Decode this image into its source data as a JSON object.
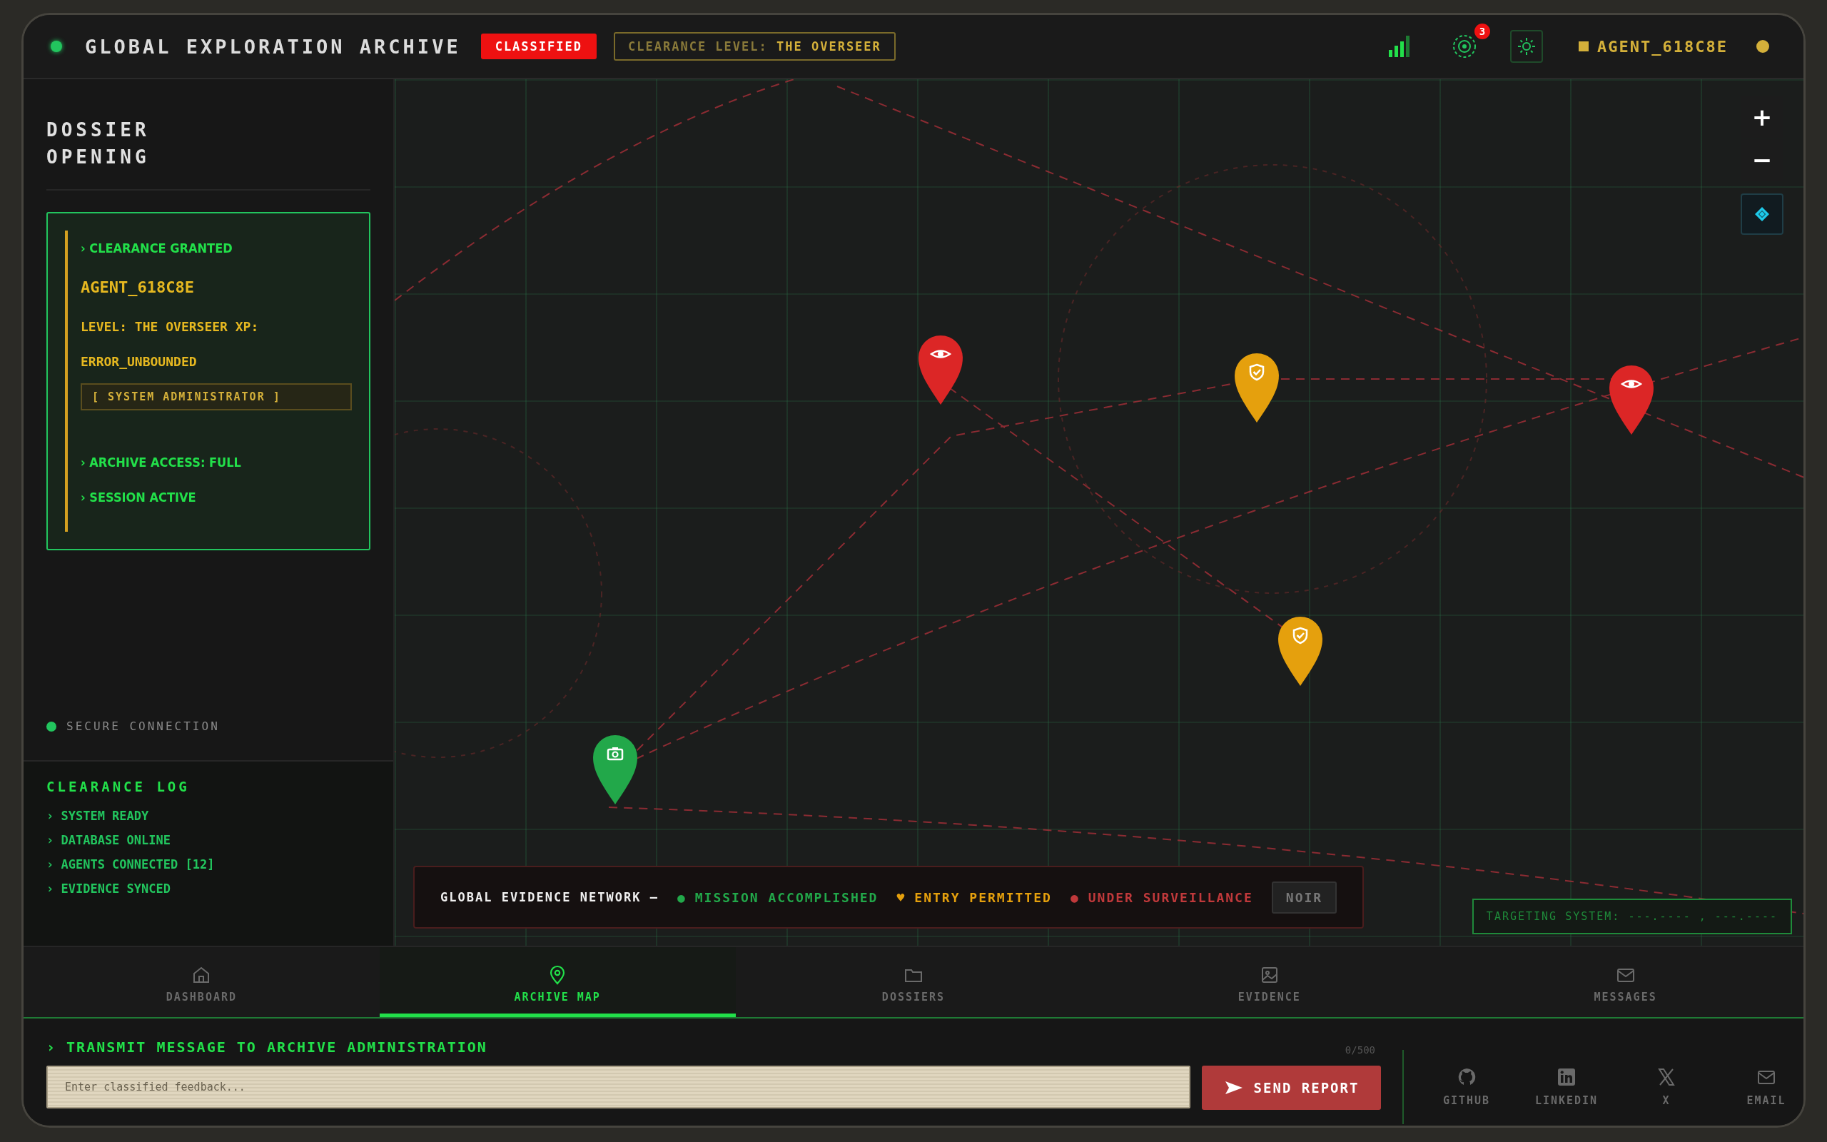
{
  "header": {
    "title": "GLOBAL EXPLORATION ARCHIVE",
    "badge": "CLASSIFIED",
    "clearance_label": "CLEARANCE LEVEL:",
    "clearance_value": "THE OVERSEER",
    "notification_count": "3",
    "agent": "AGENT_618C8E",
    "online": true
  },
  "sidebar": {
    "title": "DOSSIER OPENING",
    "card": {
      "granted": "› CLEARANCE GRANTED",
      "agent": "AGENT_618C8E",
      "level": "LEVEL: THE OVERSEER XP:",
      "xp": "ERROR_UNBOUNDED",
      "role": "[ SYSTEM ADMINISTRATOR ]",
      "access": "› ARCHIVE ACCESS: FULL",
      "session": "› SESSION ACTIVE"
    },
    "connection": {
      "label": "SECURE CONNECTION",
      "secure": true
    },
    "log": {
      "title": "CLEARANCE LOG",
      "entries": [
        "› SYSTEM READY",
        "› DATABASE ONLINE",
        "› AGENTS CONNECTED [12]",
        "› EVIDENCE SYNCED"
      ]
    }
  },
  "map": {
    "zoom_in": "+",
    "zoom_out": "−",
    "pins": [
      {
        "color": "#dc2626"
      },
      {
        "color": "#e5a00d"
      },
      {
        "color": "#dc2626"
      },
      {
        "color": "#e5a00d"
      },
      {
        "color": "#22a84a"
      }
    ],
    "legend": {
      "title": "GLOBAL EVIDENCE NETWORK —",
      "items": [
        {
          "marker": "●",
          "label": "MISSION ACCOMPLISHED",
          "color": "#22a84a"
        },
        {
          "marker": "♥",
          "label": "ENTRY PERMITTED",
          "color": "#e5a00d"
        },
        {
          "marker": "●",
          "label": "UNDER SURVEILLANCE",
          "color": "#c0393b"
        }
      ],
      "style_button": "NOIR"
    },
    "targeting": "TARGETING SYSTEM: ---.---- , ---.----"
  },
  "nav": [
    {
      "label": "DASHBOARD",
      "selected": false
    },
    {
      "label": "ARCHIVE MAP",
      "selected": true
    },
    {
      "label": "DOSSIERS",
      "selected": false
    },
    {
      "label": "EVIDENCE",
      "selected": false
    },
    {
      "label": "MESSAGES",
      "selected": false
    }
  ],
  "footer": {
    "prompt": "› TRANSMIT MESSAGE TO ARCHIVE ADMINISTRATION",
    "counter": "0/500",
    "placeholder": "Enter classified feedback...",
    "send": "SEND REPORT",
    "links": [
      "GITHUB",
      "LINKEDIN",
      "X",
      "EMAIL"
    ]
  }
}
